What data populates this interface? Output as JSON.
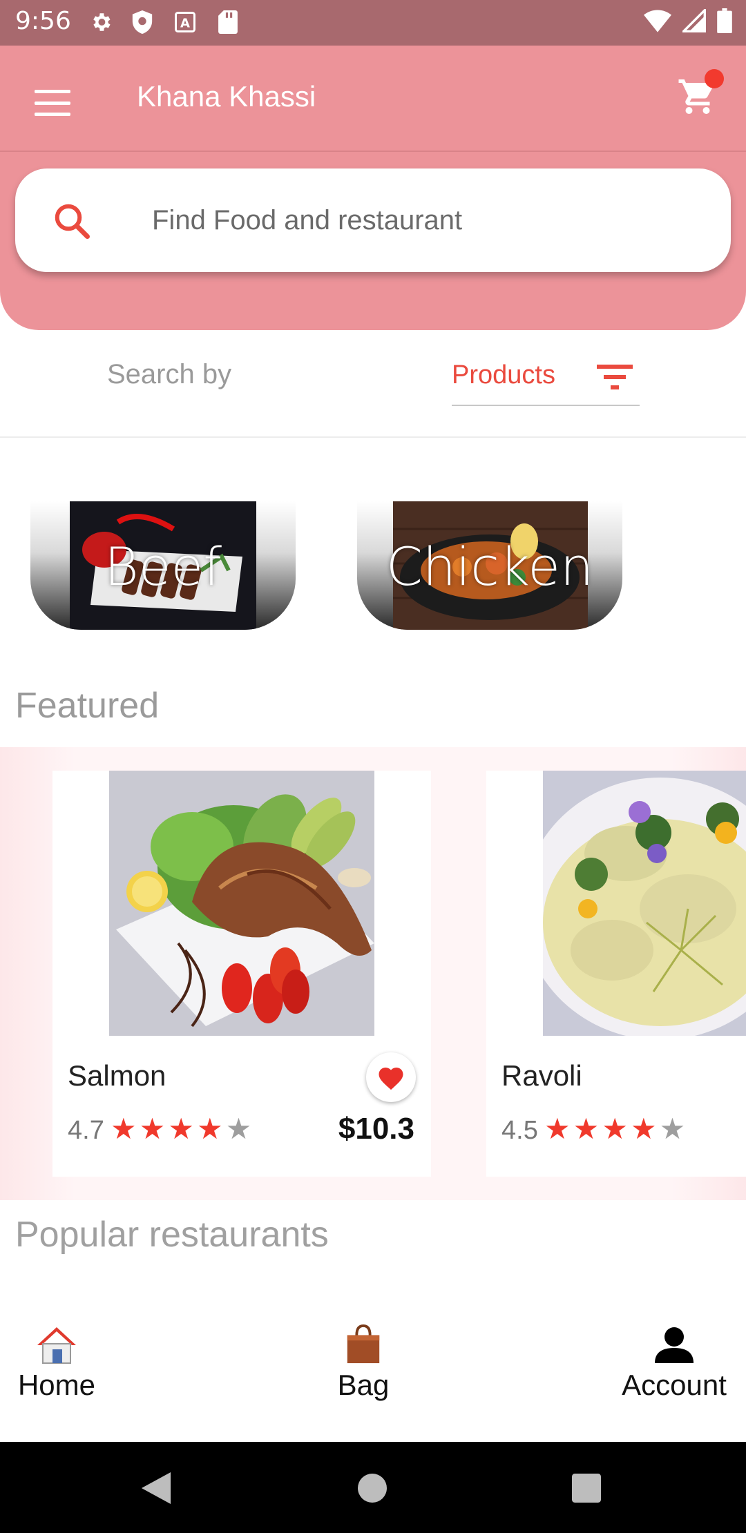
{
  "status_bar": {
    "time": "9:56"
  },
  "header": {
    "title": "Khana Khassi"
  },
  "search": {
    "placeholder": "Find Food and restaurant"
  },
  "search_by": {
    "label": "Search by",
    "selected": "Products"
  },
  "categories": [
    {
      "label": "Beef"
    },
    {
      "label": "Chicken"
    }
  ],
  "sections": {
    "featured": "Featured",
    "popular": "Popular restaurants"
  },
  "featured": [
    {
      "name": "Salmon",
      "rating": "4.7",
      "stars": 4,
      "price": "$10.3",
      "favorite": true
    },
    {
      "name": "Ravoli",
      "rating": "4.5",
      "stars": 4
    }
  ],
  "bottom_nav": [
    {
      "label": "Home",
      "icon": "home-icon"
    },
    {
      "label": "Bag",
      "icon": "bag-icon"
    },
    {
      "label": "Account",
      "icon": "account-icon"
    }
  ],
  "colors": {
    "header": "#ec9399",
    "status_bar": "#a8696e",
    "accent": "#ea4a3e"
  }
}
